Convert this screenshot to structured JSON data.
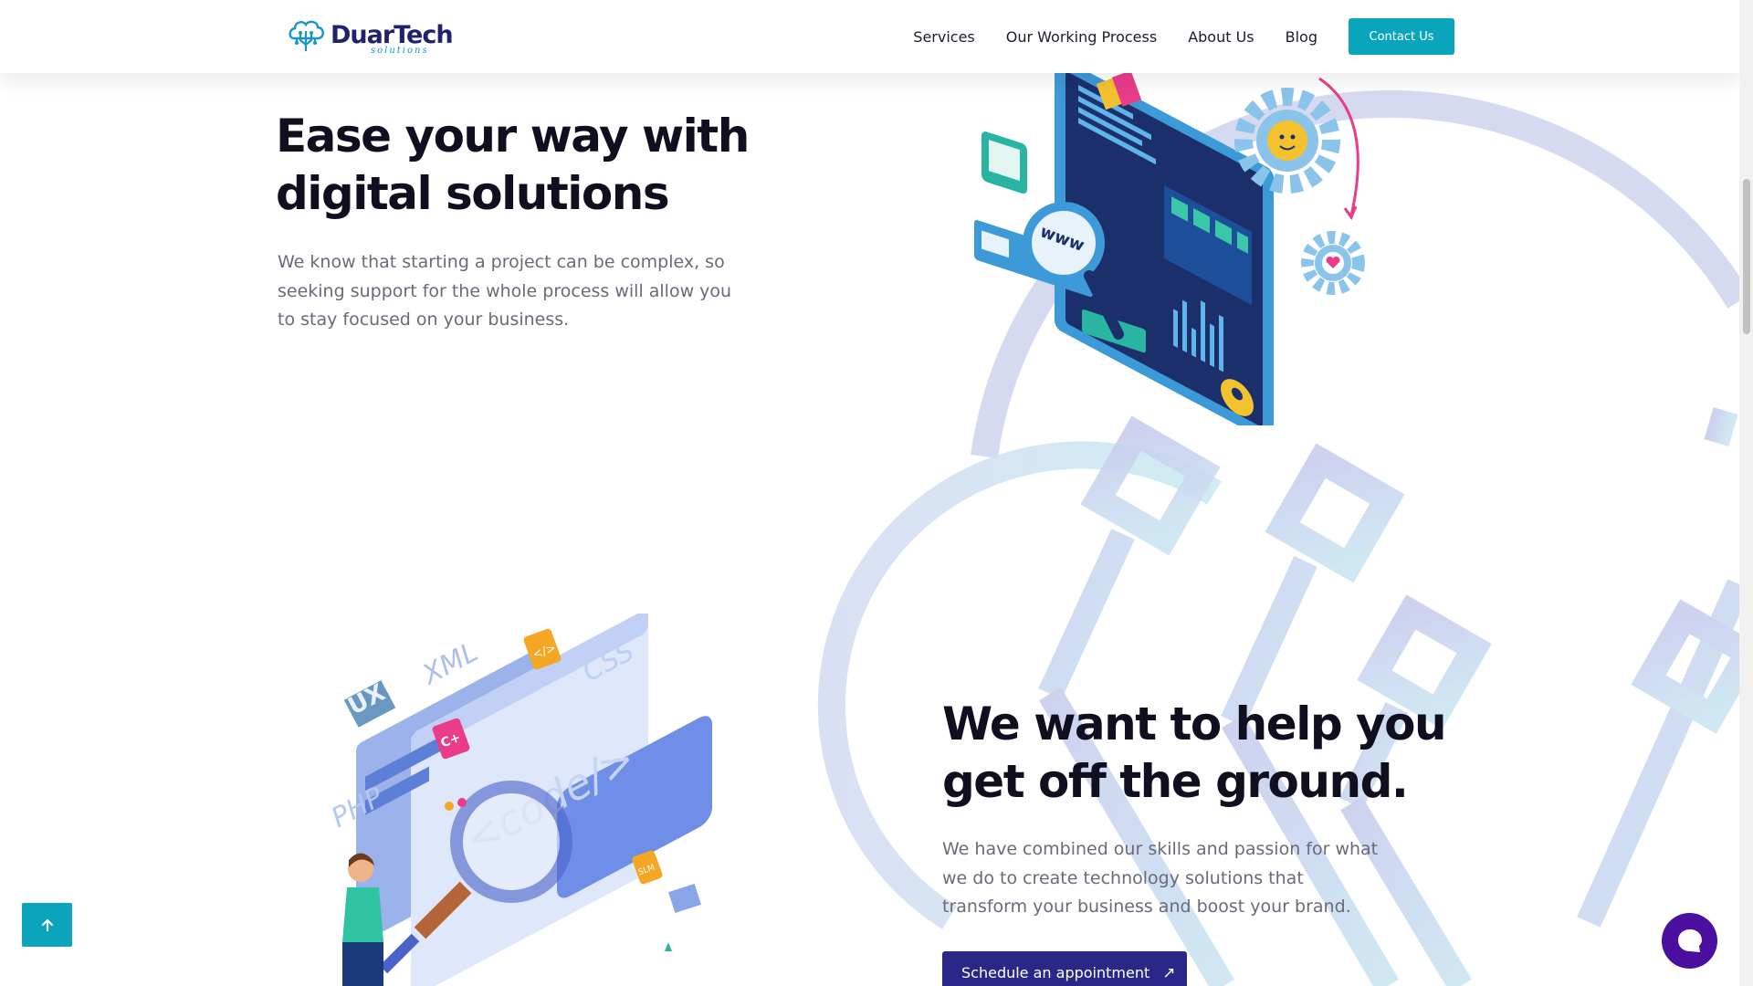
{
  "brand": {
    "name": "DuarTech",
    "tagline": "solutions",
    "accent_color": "#0aa5bd",
    "dark_color": "#2a2788",
    "chat_color": "#4a0f9e"
  },
  "nav": {
    "items": [
      "Services",
      "Our Working Process",
      "About Us",
      "Blog"
    ],
    "cta_label": "Contact Us"
  },
  "hero": {
    "title": "Ease your way with digital solutions",
    "description": "We know that starting a project can be complex, so seeking support for the whole process will allow you to stay focused on your business."
  },
  "section2": {
    "title": "We want to help you get off the ground.",
    "description": "We have combined our skills and passion for what we do to create technology solutions that transform your business and boost your brand.",
    "button_label": "Schedule an appointment"
  },
  "illustration_text": {
    "www": "www",
    "tags": [
      "UX",
      "XML",
      "CSS",
      "PHP",
      "</>",
      "C+",
      "<code/>",
      "SLM"
    ]
  },
  "icons": {
    "back_to_top": "arrow-up-icon",
    "chat": "chat-bubble-icon",
    "schedule": "arrow-up-right-icon"
  }
}
